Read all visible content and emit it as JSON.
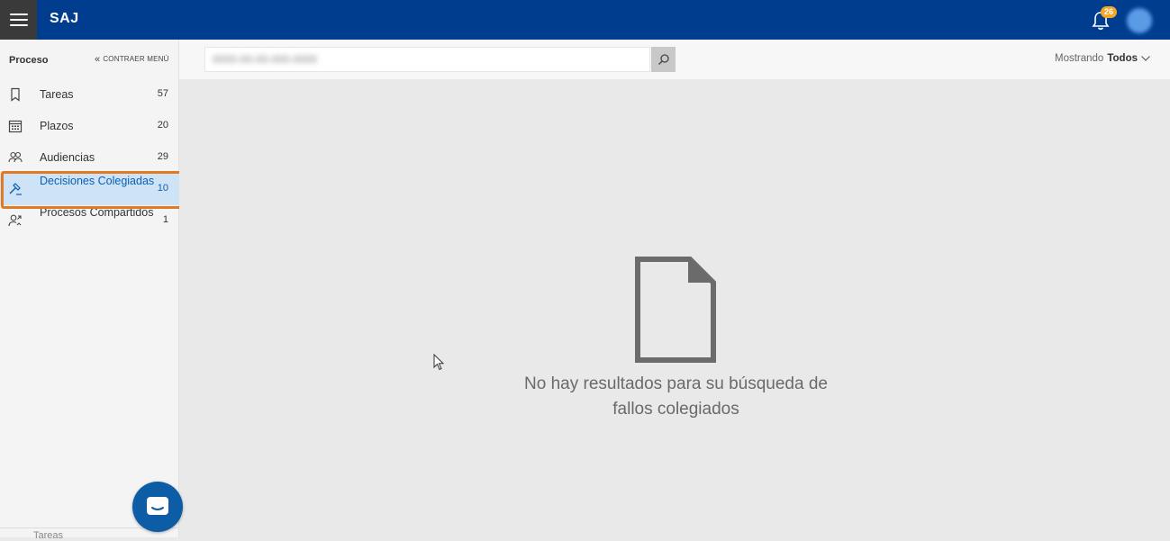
{
  "app": {
    "title": "SAJ",
    "notification_count": "26"
  },
  "sidebar": {
    "title": "Proceso",
    "collapse_label": "CONTRAER MENÚ",
    "items": [
      {
        "label": "Tareas",
        "count": "57",
        "icon": "bookmark-icon"
      },
      {
        "label": "Plazos",
        "count": "20",
        "icon": "calendar-icon"
      },
      {
        "label": "Audiencias",
        "count": "29",
        "icon": "people-icon"
      },
      {
        "label": "Decisiones Colegiadas",
        "count": "10",
        "icon": "gavel-icon",
        "active": true
      },
      {
        "label": "Procesos Compartidos",
        "count": "1",
        "icon": "shared-user-icon"
      }
    ],
    "footer_label": "Tareas"
  },
  "toolbar": {
    "search_value": "0000-00-00-000-0000",
    "filter_prefix": "Mostrando",
    "filter_value": "Todos"
  },
  "main": {
    "empty_line1": "No hay resultados para su búsqueda de",
    "empty_line2": "fallos colegiados"
  },
  "colors": {
    "topbar": "#003d8f",
    "active_item": "#cfe3f6",
    "highlight_border": "#e07a24",
    "badge": "#f5a623"
  }
}
